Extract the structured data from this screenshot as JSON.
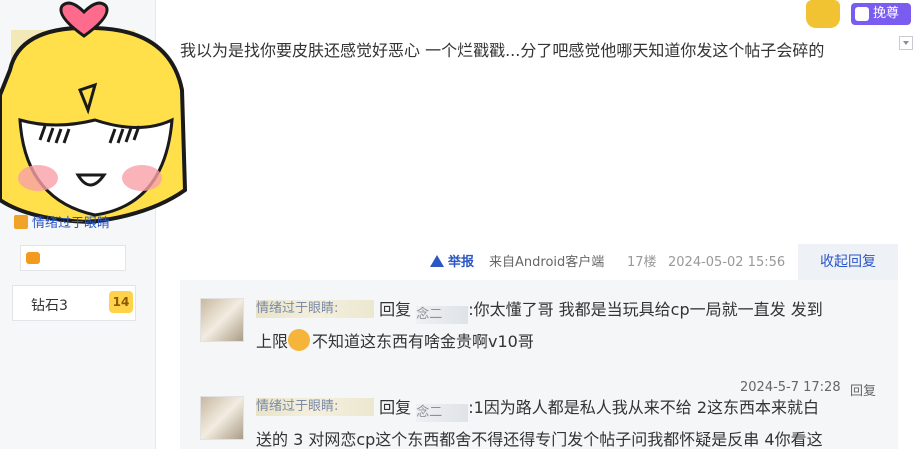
{
  "user": {
    "name": "情绪过于眼睛",
    "diamond_label": "钻石3",
    "diamond_level": "14"
  },
  "header": {
    "vip_label": "挽尊"
  },
  "post": {
    "content": "我以为是找你要皮肤还感觉好恶心 一个烂戳戳...分了吧感觉他哪天知道你发这个帖子会碎的",
    "report": "举报",
    "source": "来自Android客户端",
    "floor": "17楼",
    "date": "2024-05-02 15:56",
    "collapse": "收起回复"
  },
  "replies": [
    {
      "user": "情绪过于眼睛:",
      "reply_word": "回复",
      "mention": "念二",
      "text_part1": ":你太懂了哥 我都是当玩具给cp一局就一直发 发到",
      "text_part2": "上限",
      "text_part3": "不知道这东西有啥金贵啊v10哥",
      "time": "2024-5-7 17:28",
      "reply_btn": "回复"
    },
    {
      "user": "情绪过于眼睛:",
      "reply_word": "回复",
      "mention": "念二",
      "text_part1": ":1因为路人都是私人我从来不给 2这东西本来就白",
      "text_part2": "送的 3 对网恋cp这个东西都舍不得还得专门发个帖子问我都怀疑是反串 4你看这"
    }
  ]
}
